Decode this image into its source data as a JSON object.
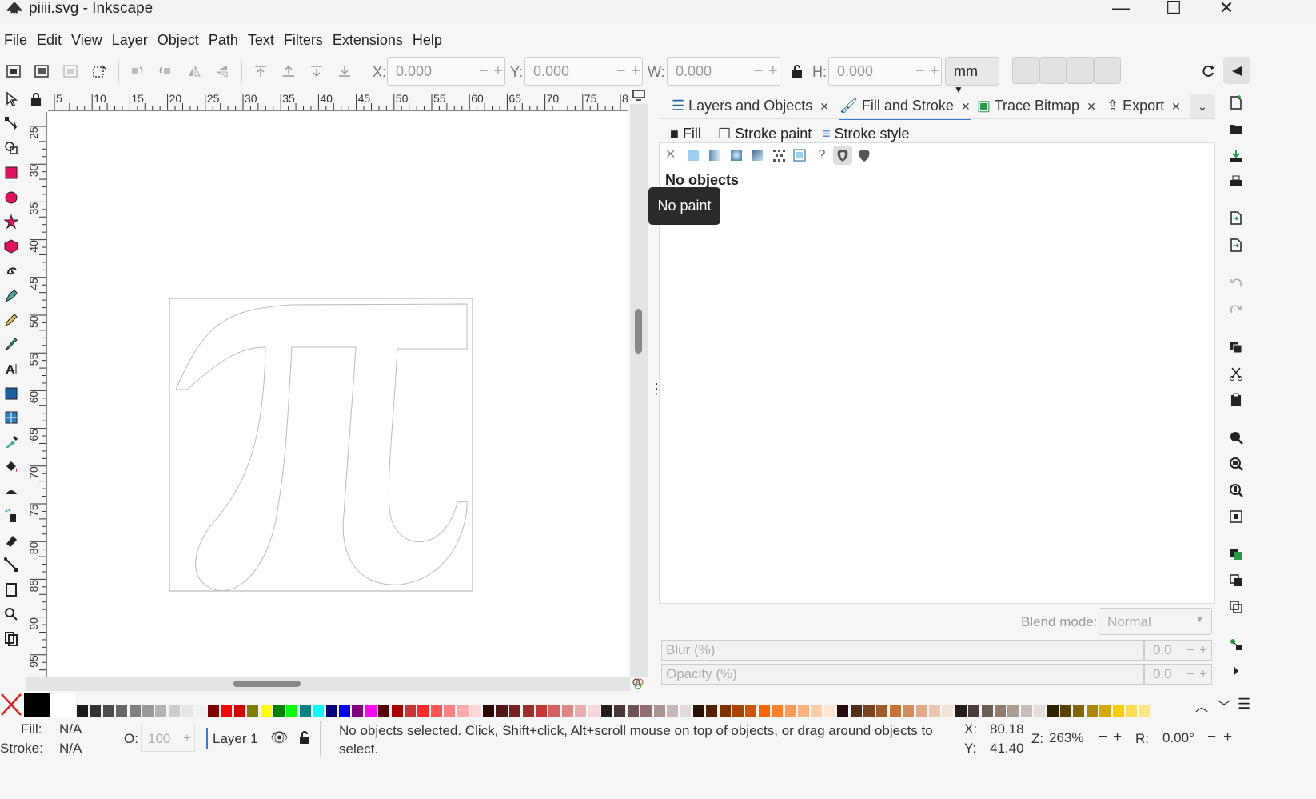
{
  "window": {
    "title": "piiii.svg - Inkscape",
    "minimize": "—",
    "maximize": "☐",
    "close": "✕"
  },
  "menu": [
    "File",
    "Edit",
    "View",
    "Layer",
    "Object",
    "Path",
    "Text",
    "Filters",
    "Extensions",
    "Help"
  ],
  "toolbar": {
    "x_label": "X:",
    "x_value": "0.000",
    "y_label": "Y:",
    "y_value": "0.000",
    "w_label": "W:",
    "w_value": "0.000",
    "h_label": "H:",
    "h_value": "0.000",
    "unit": "mm"
  },
  "rulers": {
    "h_ticks": [
      "5",
      "10",
      "15",
      "20",
      "25",
      "30",
      "35",
      "40",
      "45",
      "50",
      "55",
      "60",
      "65",
      "70",
      "75",
      "8"
    ],
    "v_ticks": [
      "25",
      "30",
      "35",
      "40",
      "45",
      "50",
      "55",
      "60",
      "65",
      "70",
      "75",
      "80",
      "85",
      "90",
      "95"
    ]
  },
  "dock": {
    "tabs": [
      {
        "label": "Layers and Objects",
        "active": false
      },
      {
        "label": "Fill and Stroke",
        "active": true
      },
      {
        "label": "Trace Bitmap",
        "active": false
      },
      {
        "label": "Export",
        "active": false
      }
    ],
    "subtabs": [
      "Fill",
      "Stroke paint",
      "Stroke style"
    ],
    "no_objects": "No objects",
    "tooltip": "No paint",
    "blend_label": "Blend mode:",
    "blend_value": "Normal",
    "blur_label": "Blur (%)",
    "blur_value": "0.0",
    "opacity_label": "Opacity (%)",
    "opacity_value": "0.0"
  },
  "status": {
    "fill_label": "Fill:",
    "fill_value": "N/A",
    "stroke_label": "Stroke:",
    "stroke_value": "N/A",
    "o_label": "O:",
    "o_value": "100",
    "layer": "Layer 1",
    "message": "No objects selected. Click, Shift+click, Alt+scroll mouse on top of objects, or drag around objects to select.",
    "x_label": "X:",
    "x_value": "80.18",
    "y_label": "Y:",
    "y_value": "41.40",
    "zoom_label": "Z:",
    "zoom_value": "263%",
    "rot_label": "R:",
    "rot_value": "0.00°"
  },
  "palette_colors": [
    "#1a1a1a",
    "#333333",
    "#4d4d4d",
    "#666666",
    "#808080",
    "#999999",
    "#b3b3b3",
    "#cccccc",
    "#e6e6e6",
    "#f2f2f2",
    "#800000",
    "#ff0000",
    "#d40000",
    "#808000",
    "#ffff00",
    "#008000",
    "#00ff00",
    "#008080",
    "#00ffff",
    "#000080",
    "#0000ff",
    "#800080",
    "#ff00ff",
    "#550000",
    "#aa0000",
    "#c83737",
    "#ff2a2a",
    "#ff5555",
    "#ff8080",
    "#ffaaaa",
    "#ffd5d5",
    "#2b0000",
    "#501616",
    "#782121",
    "#a02c2c",
    "#c83737",
    "#d35f5f",
    "#de8787",
    "#e9afaf",
    "#f4d7d7",
    "#241c1c",
    "#483737",
    "#6c5353",
    "#916f6f",
    "#ac9393",
    "#c8b7b7",
    "#e3dbdb",
    "#2b1100",
    "#552200",
    "#803300",
    "#aa4400",
    "#d45500",
    "#ff6600",
    "#ff7f2a",
    "#ff9955",
    "#ffb380",
    "#ffccaa",
    "#ffe6d5",
    "#280b0b",
    "#502d16",
    "#784421",
    "#a05a2c",
    "#c87137",
    "#d38d5f",
    "#deaa87",
    "#e9c6af",
    "#f4e3d7",
    "#241f1c",
    "#483e37",
    "#6c5d53",
    "#917c6f",
    "#ac9d93",
    "#c8beb7",
    "#e3dedb",
    "#2b2200",
    "#554400",
    "#806600",
    "#aa8800",
    "#d4aa00",
    "#ffcc00",
    "#ffdd55",
    "#ffe680"
  ]
}
